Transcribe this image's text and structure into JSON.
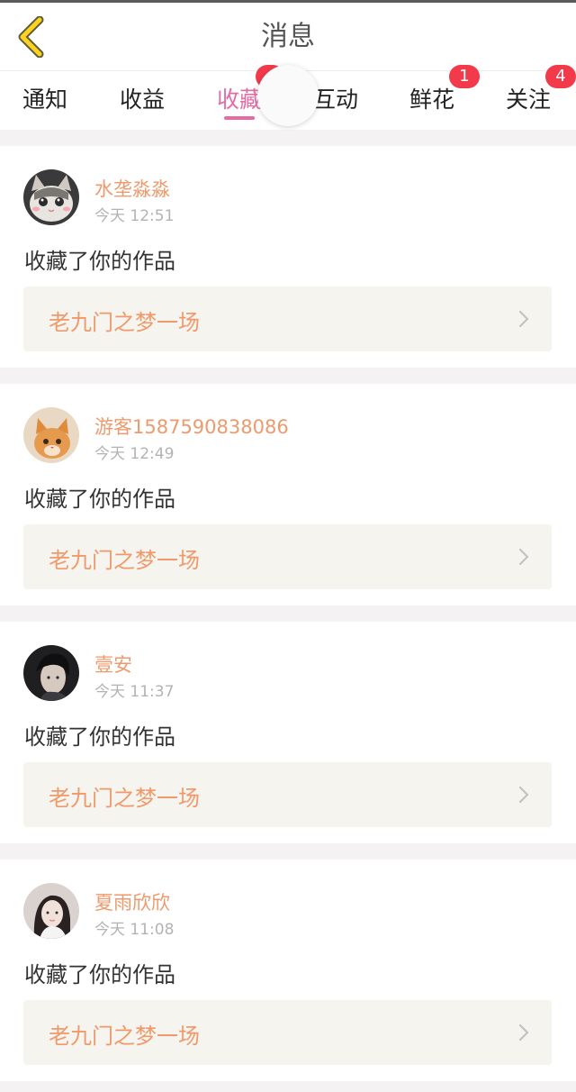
{
  "header": {
    "title": "消息",
    "back_icon": "chevron-left-icon",
    "back_color": "#ffd21f"
  },
  "tabs": [
    {
      "label": "通知",
      "badge": ""
    },
    {
      "label": "收益",
      "badge": ""
    },
    {
      "label": "收藏",
      "badge": "",
      "active": true
    },
    {
      "label": "互动",
      "badge": ""
    },
    {
      "label": "鲜花",
      "badge": "1"
    },
    {
      "label": "关注",
      "badge": "4"
    }
  ],
  "colors": {
    "accent_pink": "#e76ba2",
    "name_orange": "#ee9a6c",
    "badge_red": "#f23a4a"
  },
  "feed": [
    {
      "username": "水垄淼淼",
      "time": "今天 12:51",
      "action": "收藏了你的作品",
      "work": "老九门之梦一场",
      "avatar_icon": "cat-avatar-icon"
    },
    {
      "username": "游客1587590838086",
      "time": "今天 12:49",
      "action": "收藏了你的作品",
      "work": "老九门之梦一场",
      "avatar_icon": "kitten-avatar-icon"
    },
    {
      "username": "壹安",
      "time": "今天 11:37",
      "action": "收藏了你的作品",
      "work": "老九门之梦一场",
      "avatar_icon": "person-avatar-icon"
    },
    {
      "username": "夏雨欣欣",
      "time": "今天 11:08",
      "action": "收藏了你的作品",
      "work": "老九门之梦一场",
      "avatar_icon": "girl-avatar-icon"
    }
  ]
}
